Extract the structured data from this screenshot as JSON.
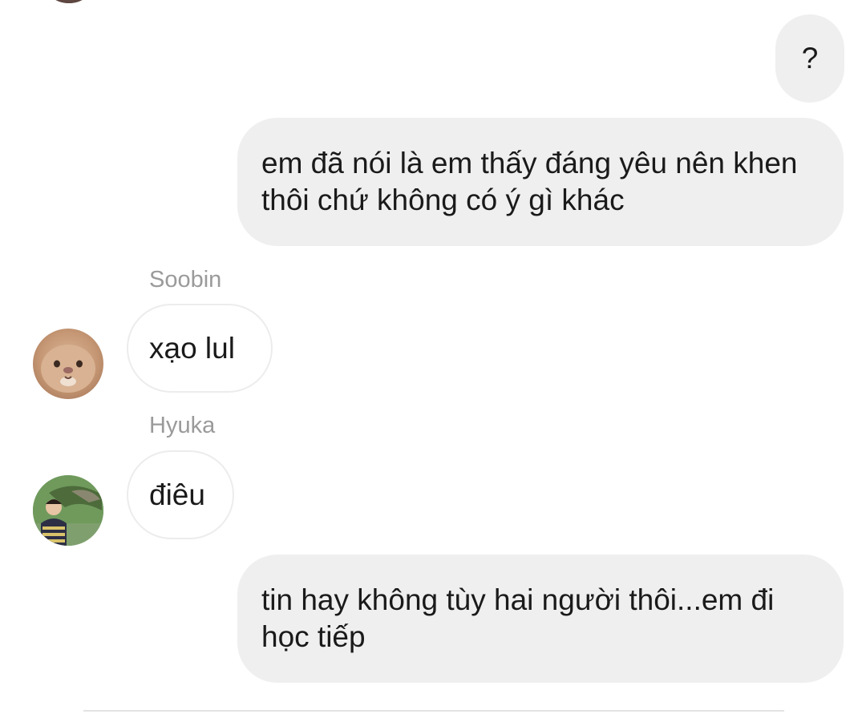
{
  "conversation": {
    "messages": [
      {
        "sender": "me",
        "text": "?"
      },
      {
        "sender": "me",
        "text": "em đã nói là em thấy đáng yêu nên khen thôi chứ không có ý gì khác"
      },
      {
        "sender": "Soobin",
        "text": "xạo lul"
      },
      {
        "sender": "Hyuka",
        "text": "điêu"
      },
      {
        "sender": "me",
        "text": "tin hay không tùy hai người thôi...em đi học tiếp"
      }
    ]
  },
  "colors": {
    "outgoing_bubble": "#efefef",
    "incoming_bubble_border": "#ececec",
    "sender_name": "#9a9a9a",
    "text": "#1a1a1a"
  }
}
